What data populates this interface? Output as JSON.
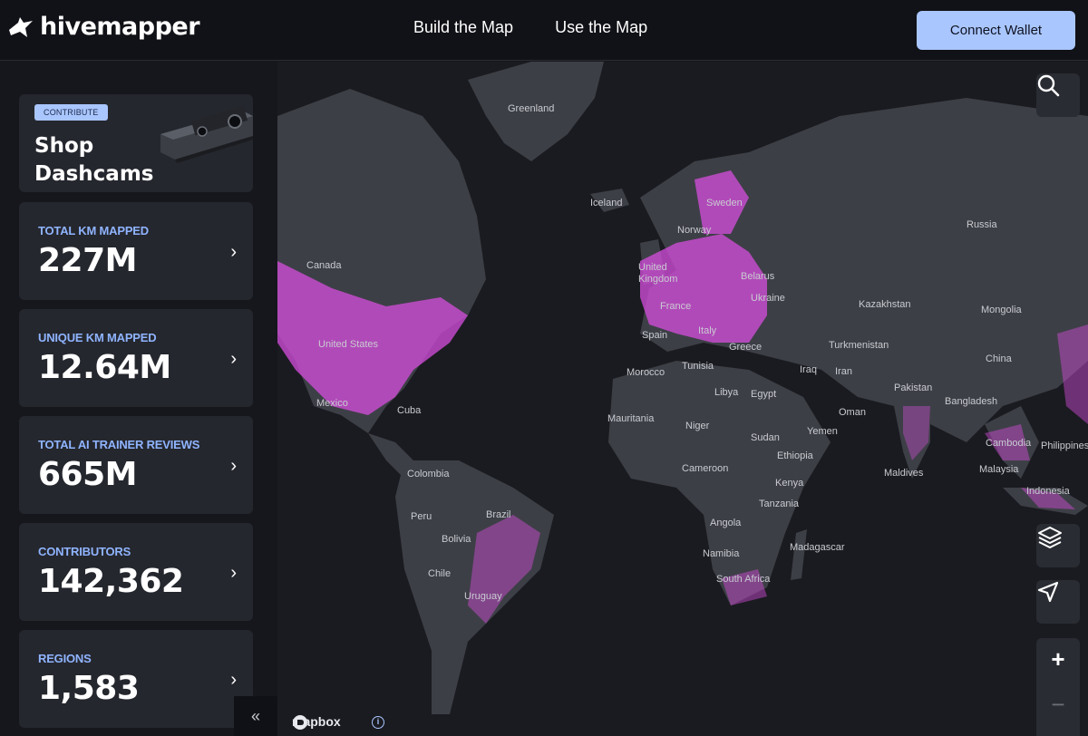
{
  "header": {
    "logo_text": "hivemapper",
    "nav": [
      {
        "label": "Build the Map"
      },
      {
        "label": "Use the Map"
      }
    ],
    "connect_wallet": "Connect Wallet"
  },
  "sidebar": {
    "promo": {
      "badge": "CONTRIBUTE",
      "title": "Shop Dashcams"
    },
    "stats": [
      {
        "label": "TOTAL KM MAPPED",
        "value": "227M"
      },
      {
        "label": "UNIQUE KM MAPPED",
        "value": "12.64M"
      },
      {
        "label": "TOTAL AI TRAINER REVIEWS",
        "value": "665M"
      },
      {
        "label": "CONTRIBUTORS",
        "value": "142,362"
      },
      {
        "label": "REGIONS",
        "value": "1,583"
      }
    ],
    "collapse_glyph": "«"
  },
  "map": {
    "attribution": "mapbox",
    "info_glyph": "i",
    "zoom_in": "+",
    "zoom_out": "−",
    "coverage_color": "#d94fe0",
    "labels": [
      {
        "text": "Greenland"
      },
      {
        "text": "Iceland"
      },
      {
        "text": "Sweden"
      },
      {
        "text": "Norway"
      },
      {
        "text": "Russia"
      },
      {
        "text": "Canada"
      },
      {
        "text": "United Kingdom"
      },
      {
        "text": "Belarus"
      },
      {
        "text": "Ukraine"
      },
      {
        "text": "Kazakhstan"
      },
      {
        "text": "Mongolia"
      },
      {
        "text": "France"
      },
      {
        "text": "Italy"
      },
      {
        "text": "Spain"
      },
      {
        "text": "Greece"
      },
      {
        "text": "Turkmenistan"
      },
      {
        "text": "United States"
      },
      {
        "text": "China"
      },
      {
        "text": "Morocco"
      },
      {
        "text": "Tunisia"
      },
      {
        "text": "Iraq"
      },
      {
        "text": "Iran"
      },
      {
        "text": "Libya"
      },
      {
        "text": "Egypt"
      },
      {
        "text": "Pakistan"
      },
      {
        "text": "Bangladesh"
      },
      {
        "text": "Mexico"
      },
      {
        "text": "Cuba"
      },
      {
        "text": "Mauritania"
      },
      {
        "text": "Niger"
      },
      {
        "text": "Oman"
      },
      {
        "text": "Yemen"
      },
      {
        "text": "Sudan"
      },
      {
        "text": "Cambodia"
      },
      {
        "text": "Philippines"
      },
      {
        "text": "Ethiopia"
      },
      {
        "text": "Colombia"
      },
      {
        "text": "Cameroon"
      },
      {
        "text": "Maldives"
      },
      {
        "text": "Malaysia"
      },
      {
        "text": "Kenya"
      },
      {
        "text": "Indonesia"
      },
      {
        "text": "Tanzania"
      },
      {
        "text": "Peru"
      },
      {
        "text": "Brazil"
      },
      {
        "text": "Angola"
      },
      {
        "text": "Bolivia"
      },
      {
        "text": "Namibia"
      },
      {
        "text": "Madagascar"
      },
      {
        "text": "Chile"
      },
      {
        "text": "South Africa"
      },
      {
        "text": "Uruguay"
      }
    ]
  }
}
